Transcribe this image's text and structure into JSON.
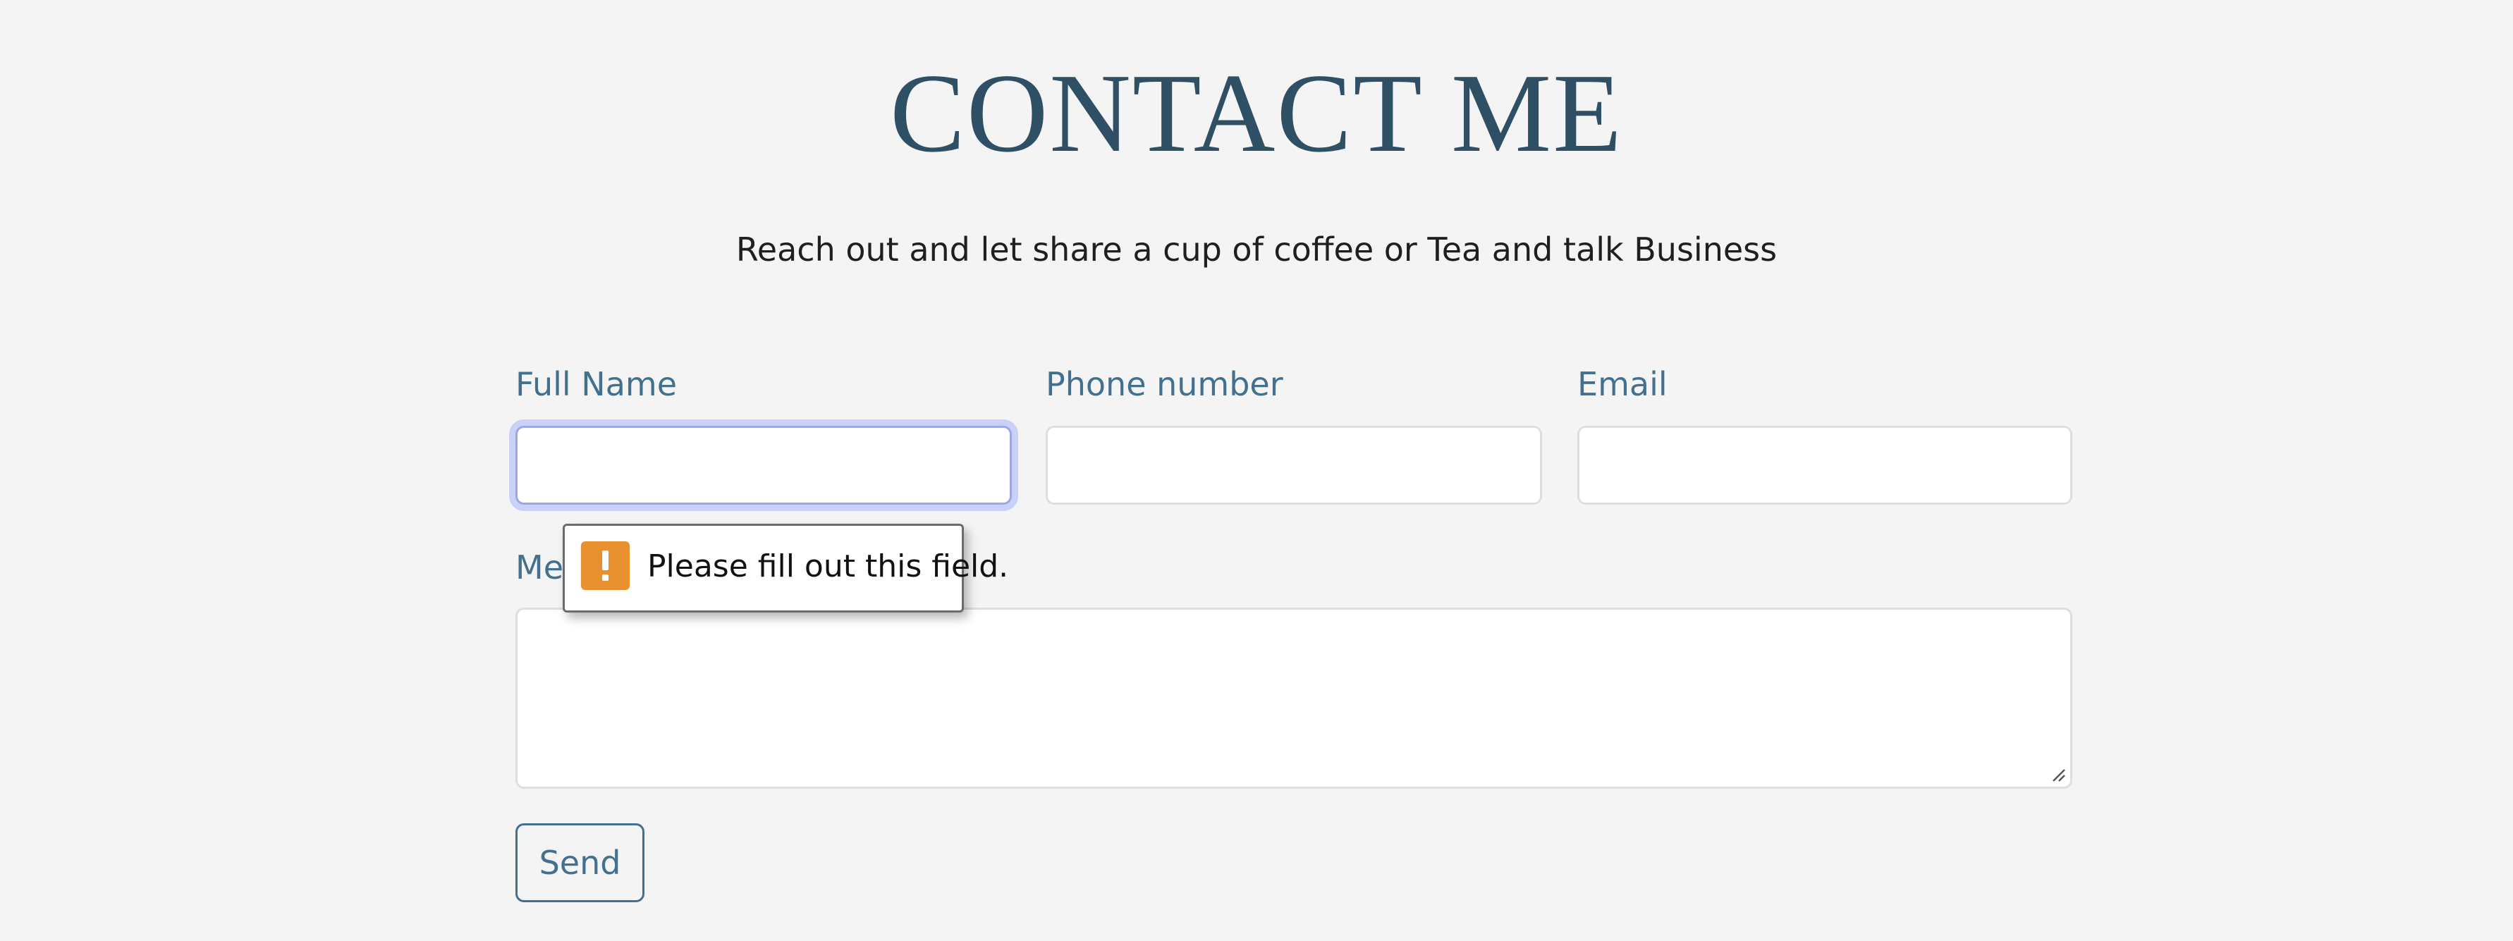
{
  "header": {
    "title": "CONTACT ME",
    "subtitle": "Reach out and let share a cup of coffee or Tea and talk Business"
  },
  "form": {
    "full_name_label": "Full Name",
    "full_name_value": "",
    "phone_label": "Phone number",
    "phone_value": "",
    "email_label": "Email",
    "email_value": "",
    "message_label": "Message",
    "message_value": "",
    "send_label": "Send"
  },
  "validation_tooltip": {
    "text": "Please fill out this field.",
    "icon": "warning-exclamation-icon",
    "icon_color": "#e8902f"
  },
  "colors": {
    "title": "#2f4f65",
    "label": "#44708f",
    "background": "#f4f4f4",
    "focus_ring": "#c9d1f7"
  }
}
